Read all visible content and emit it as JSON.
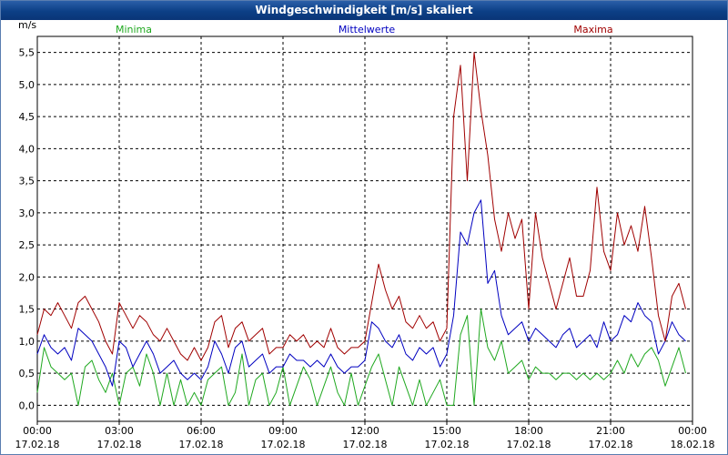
{
  "window": {
    "title": "Windgeschwindigkeit [m/s] skaliert"
  },
  "colors": {
    "minima": "#1fa81f",
    "mittelwerte": "#0000c0",
    "maxima": "#a00000",
    "grid": "#000000",
    "title_bar": "#0c3f86"
  },
  "chart_data": {
    "type": "line",
    "title": "Windgeschwindigkeit [m/s] skaliert",
    "ylabel": "m/s",
    "xlabel": "",
    "ylim": [
      -0.25,
      5.75
    ],
    "xlim_hours": [
      0,
      24
    ],
    "grid": true,
    "legend_placement": "top",
    "y_ticks": [
      "0,0",
      "0,5",
      "1,0",
      "1,5",
      "2,0",
      "2,5",
      "3,0",
      "3,5",
      "4,0",
      "4,5",
      "5,0",
      "5,5"
    ],
    "x_ticks": [
      {
        "time": "00:00",
        "date": "17.02.18"
      },
      {
        "time": "03:00",
        "date": "17.02.18"
      },
      {
        "time": "06:00",
        "date": "17.02.18"
      },
      {
        "time": "09:00",
        "date": "17.02.18"
      },
      {
        "time": "12:00",
        "date": "17.02.18"
      },
      {
        "time": "15:00",
        "date": "17.02.18"
      },
      {
        "time": "18:00",
        "date": "17.02.18"
      },
      {
        "time": "21:00",
        "date": "17.02.18"
      },
      {
        "time": "00:00",
        "date": "18.02.18"
      }
    ],
    "series": [
      {
        "name": "Minima",
        "x_hours": [
          0,
          0.25,
          0.5,
          0.75,
          1,
          1.25,
          1.5,
          1.75,
          2,
          2.25,
          2.5,
          2.75,
          3,
          3.25,
          3.5,
          3.75,
          4,
          4.25,
          4.5,
          4.75,
          5,
          5.25,
          5.5,
          5.75,
          6,
          6.25,
          6.5,
          6.75,
          7,
          7.25,
          7.5,
          7.75,
          8,
          8.25,
          8.5,
          8.75,
          9,
          9.25,
          9.5,
          9.75,
          10,
          10.25,
          10.5,
          10.75,
          11,
          11.25,
          11.5,
          11.75,
          12,
          12.25,
          12.5,
          12.75,
          13,
          13.25,
          13.5,
          13.75,
          14,
          14.25,
          14.5,
          14.75,
          15,
          15.25,
          15.5,
          15.75,
          16,
          16.25,
          16.5,
          16.75,
          17,
          17.25,
          17.5,
          17.75,
          18,
          18.25,
          18.5,
          18.75,
          19,
          19.25,
          19.5,
          19.75,
          20,
          20.25,
          20.5,
          20.75,
          21,
          21.25,
          21.5,
          21.75,
          22,
          22.25,
          22.5,
          22.75,
          23,
          23.25,
          23.5,
          23.75
        ],
        "values": [
          0.2,
          0.9,
          0.6,
          0.5,
          0.4,
          0.5,
          0.0,
          0.6,
          0.7,
          0.4,
          0.2,
          0.5,
          0.0,
          0.5,
          0.6,
          0.3,
          0.8,
          0.5,
          0.0,
          0.5,
          0.0,
          0.4,
          0.0,
          0.2,
          0.0,
          0.4,
          0.5,
          0.6,
          0.0,
          0.2,
          0.8,
          0.0,
          0.4,
          0.5,
          0.0,
          0.2,
          0.6,
          0.0,
          0.3,
          0.6,
          0.4,
          0.0,
          0.3,
          0.6,
          0.2,
          0.0,
          0.5,
          0.0,
          0.3,
          0.6,
          0.8,
          0.4,
          0.0,
          0.6,
          0.3,
          0.0,
          0.4,
          0.0,
          0.2,
          0.4,
          0.0,
          0.0,
          1.1,
          1.4,
          0.0,
          1.5,
          0.9,
          0.7,
          1.0,
          0.5,
          0.6,
          0.7,
          0.4,
          0.6,
          0.5,
          0.5,
          0.4,
          0.5,
          0.5,
          0.4,
          0.5,
          0.4,
          0.5,
          0.4,
          0.5,
          0.7,
          0.5,
          0.8,
          0.6,
          0.8,
          0.9,
          0.7,
          0.3,
          0.6,
          0.9,
          0.5
        ]
      },
      {
        "name": "Mittelwerte",
        "x_hours": [
          0,
          0.25,
          0.5,
          0.75,
          1,
          1.25,
          1.5,
          1.75,
          2,
          2.25,
          2.5,
          2.75,
          3,
          3.25,
          3.5,
          3.75,
          4,
          4.25,
          4.5,
          4.75,
          5,
          5.25,
          5.5,
          5.75,
          6,
          6.25,
          6.5,
          6.75,
          7,
          7.25,
          7.5,
          7.75,
          8,
          8.25,
          8.5,
          8.75,
          9,
          9.25,
          9.5,
          9.75,
          10,
          10.25,
          10.5,
          10.75,
          11,
          11.25,
          11.5,
          11.75,
          12,
          12.25,
          12.5,
          12.75,
          13,
          13.25,
          13.5,
          13.75,
          14,
          14.25,
          14.5,
          14.75,
          15,
          15.25,
          15.5,
          15.75,
          16,
          16.25,
          16.5,
          16.75,
          17,
          17.25,
          17.5,
          17.75,
          18,
          18.25,
          18.5,
          18.75,
          19,
          19.25,
          19.5,
          19.75,
          20,
          20.25,
          20.5,
          20.75,
          21,
          21.25,
          21.5,
          21.75,
          22,
          22.25,
          22.5,
          22.75,
          23,
          23.25,
          23.5,
          23.75
        ],
        "values": [
          0.8,
          1.1,
          0.9,
          0.8,
          0.9,
          0.7,
          1.2,
          1.1,
          1.0,
          0.8,
          0.6,
          0.3,
          1.0,
          0.9,
          0.6,
          0.8,
          1.0,
          0.8,
          0.5,
          0.6,
          0.7,
          0.5,
          0.4,
          0.5,
          0.4,
          0.6,
          1.0,
          0.8,
          0.5,
          0.9,
          1.0,
          0.6,
          0.7,
          0.8,
          0.5,
          0.6,
          0.6,
          0.8,
          0.7,
          0.7,
          0.6,
          0.7,
          0.6,
          0.8,
          0.6,
          0.5,
          0.6,
          0.6,
          0.7,
          1.3,
          1.2,
          1.0,
          0.9,
          1.1,
          0.8,
          0.7,
          0.9,
          0.8,
          0.9,
          0.6,
          0.8,
          1.4,
          2.7,
          2.5,
          3.0,
          3.2,
          1.9,
          2.1,
          1.4,
          1.1,
          1.2,
          1.3,
          1.0,
          1.2,
          1.1,
          1.0,
          0.9,
          1.1,
          1.2,
          0.9,
          1.0,
          1.1,
          0.9,
          1.3,
          1.0,
          1.1,
          1.4,
          1.3,
          1.6,
          1.4,
          1.3,
          0.8,
          1.0,
          1.3,
          1.1,
          1.0
        ]
      },
      {
        "name": "Maxima",
        "x_hours": [
          0,
          0.25,
          0.5,
          0.75,
          1,
          1.25,
          1.5,
          1.75,
          2,
          2.25,
          2.5,
          2.75,
          3,
          3.25,
          3.5,
          3.75,
          4,
          4.25,
          4.5,
          4.75,
          5,
          5.25,
          5.5,
          5.75,
          6,
          6.25,
          6.5,
          6.75,
          7,
          7.25,
          7.5,
          7.75,
          8,
          8.25,
          8.5,
          8.75,
          9,
          9.25,
          9.5,
          9.75,
          10,
          10.25,
          10.5,
          10.75,
          11,
          11.25,
          11.5,
          11.75,
          12,
          12.25,
          12.5,
          12.75,
          13,
          13.25,
          13.5,
          13.75,
          14,
          14.25,
          14.5,
          14.75,
          15,
          15.25,
          15.5,
          15.75,
          16,
          16.25,
          16.5,
          16.75,
          17,
          17.25,
          17.5,
          17.75,
          18,
          18.25,
          18.5,
          18.75,
          19,
          19.25,
          19.5,
          19.75,
          20,
          20.25,
          20.5,
          20.75,
          21,
          21.25,
          21.5,
          21.75,
          22,
          22.25,
          22.5,
          22.75,
          23,
          23.25,
          23.5,
          23.75
        ],
        "values": [
          1.1,
          1.5,
          1.4,
          1.6,
          1.4,
          1.2,
          1.6,
          1.7,
          1.5,
          1.3,
          1.0,
          0.8,
          1.6,
          1.4,
          1.2,
          1.4,
          1.3,
          1.1,
          1.0,
          1.2,
          1.0,
          0.8,
          0.7,
          0.9,
          0.7,
          0.9,
          1.3,
          1.4,
          0.9,
          1.2,
          1.3,
          1.0,
          1.1,
          1.2,
          0.8,
          0.9,
          0.9,
          1.1,
          1.0,
          1.1,
          0.9,
          1.0,
          0.9,
          1.2,
          0.9,
          0.8,
          0.9,
          0.9,
          1.0,
          1.6,
          2.2,
          1.8,
          1.5,
          1.7,
          1.3,
          1.2,
          1.4,
          1.2,
          1.3,
          1.0,
          1.2,
          4.5,
          5.3,
          3.5,
          5.5,
          4.6,
          3.9,
          2.9,
          2.4,
          3.0,
          2.6,
          2.9,
          1.5,
          3.0,
          2.3,
          1.9,
          1.5,
          1.9,
          2.3,
          1.7,
          1.7,
          2.1,
          3.4,
          2.4,
          2.1,
          3.0,
          2.5,
          2.8,
          2.4,
          3.1,
          2.3,
          1.4,
          1.0,
          1.7,
          1.9,
          1.5
        ]
      }
    ]
  }
}
